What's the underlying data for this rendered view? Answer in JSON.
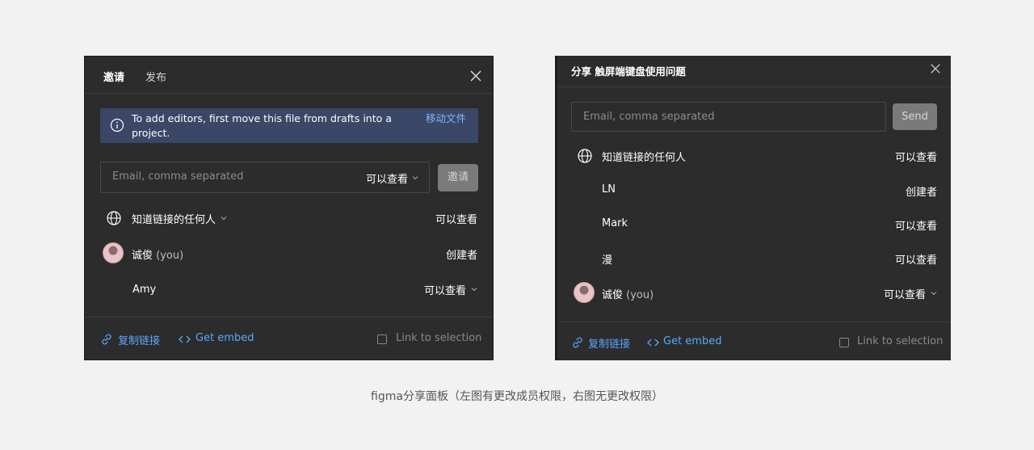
{
  "left_panel": {
    "tabs": [
      {
        "label": "邀请"
      },
      {
        "label": "发布"
      }
    ],
    "banner": {
      "text": "To add editors, first move this file from drafts into a project.",
      "link": "移动文件"
    },
    "invite": {
      "placeholder": "Email, comma separated",
      "permission": "可以查看",
      "button": "邀请"
    },
    "rows": [
      {
        "label": "知道链接的任何人",
        "permission": "可以查看"
      },
      {
        "label": "诚俊",
        "suffix": "(you)",
        "permission": "创建者"
      },
      {
        "label": "Amy",
        "permission": "可以查看"
      }
    ],
    "footer": {
      "copy_link": "复制链接",
      "get_embed": "Get embed",
      "link_to_selection": "Link to selection"
    }
  },
  "right_panel": {
    "title": "分享 触屏端键盘使用问题",
    "invite": {
      "placeholder": "Email, comma separated",
      "button": "Send"
    },
    "rows": [
      {
        "label": "知道链接的任何人",
        "permission": "可以查看"
      },
      {
        "label": "LN",
        "permission": "创建者"
      },
      {
        "label": "Mark",
        "permission": "可以查看"
      },
      {
        "label": "漫",
        "permission": "可以查看"
      },
      {
        "label": "诚俊",
        "suffix": "(you)",
        "permission": "可以查看"
      }
    ],
    "footer": {
      "copy_link": "复制链接",
      "get_embed": "Get embed",
      "link_to_selection": "Link to selection"
    }
  },
  "caption": "figma分享面板（左图有更改成员权限，右图无更改权限）",
  "colors": {
    "page_bg": "#f2f2f2",
    "panel_bg": "#2c2c2c",
    "banner_bg": "#3a4766",
    "link_blue": "#59a6ff",
    "disabled_button": "#7a7a7a"
  }
}
